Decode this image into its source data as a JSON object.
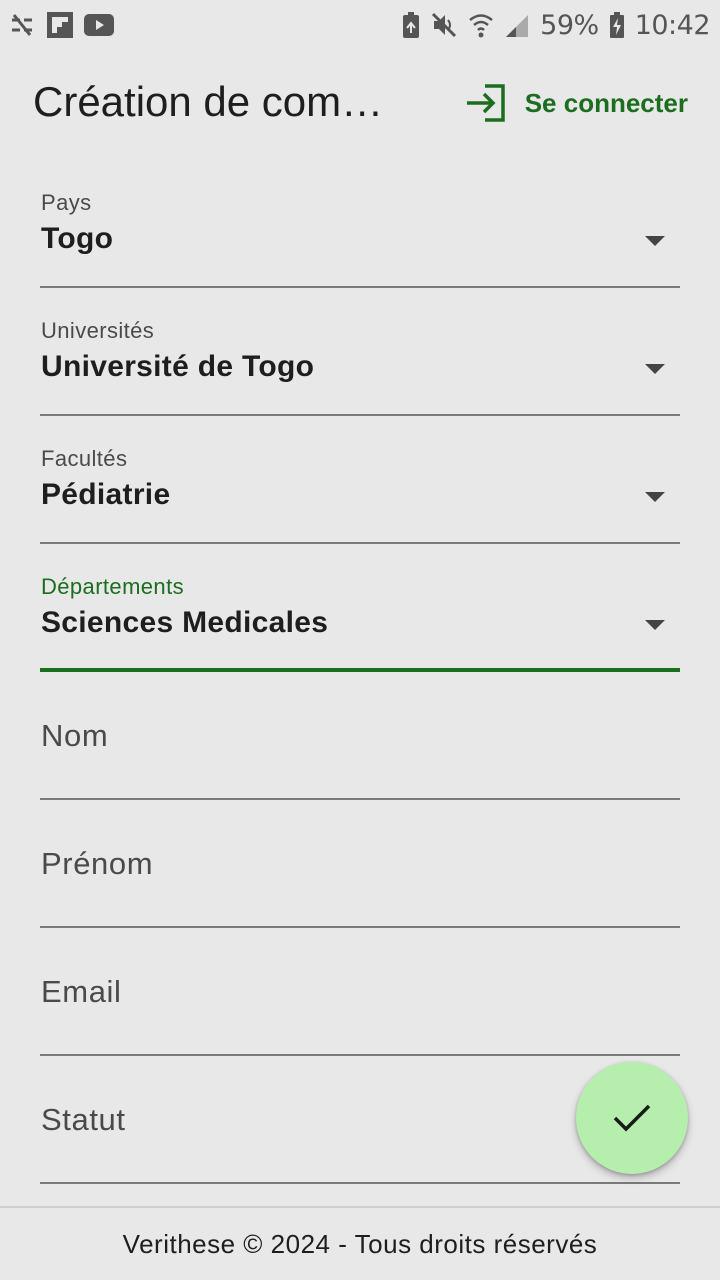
{
  "status_bar": {
    "icons_left": [
      "no-sync-icon",
      "flipboard-icon",
      "youtube-icon"
    ],
    "icons_right": [
      "battery-saver-icon",
      "mute-icon",
      "wifi-icon",
      "signal-icon",
      "battery-charging-icon"
    ],
    "battery_percent": "59%",
    "time": "10:42"
  },
  "header": {
    "title": "Création de com…",
    "login_label": "Se connecter",
    "login_icon": "login-icon"
  },
  "form": {
    "country": {
      "label": "Pays",
      "value": "Togo"
    },
    "university": {
      "label": "Universités",
      "value": "Université de Togo"
    },
    "faculty": {
      "label": "Facultés",
      "value": "Pédiatrie"
    },
    "department": {
      "label": "Départements",
      "value": "Sciences Medicales"
    },
    "last_name": {
      "placeholder": "Nom"
    },
    "first_name": {
      "placeholder": "Prénom"
    },
    "email": {
      "placeholder": "Email"
    },
    "status": {
      "placeholder": "Statut"
    }
  },
  "fab": {
    "icon": "check-icon"
  },
  "footer": {
    "text": "Verithese © 2024 - Tous droits réservés"
  },
  "colors": {
    "accent": "#1b6e1f",
    "fab_background": "#b6eeae",
    "background": "#e8e8e8"
  }
}
